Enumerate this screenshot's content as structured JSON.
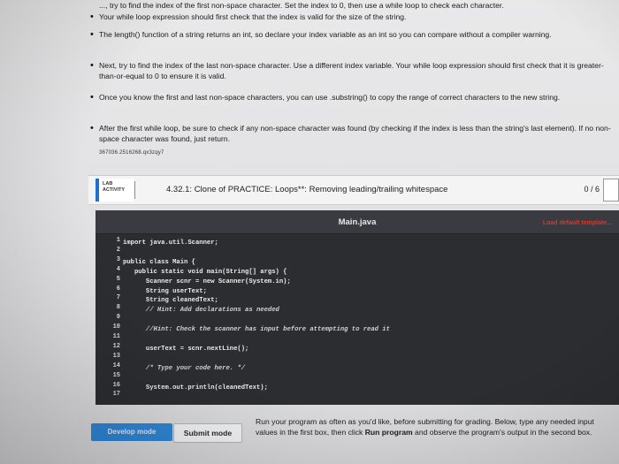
{
  "instructions": {
    "bullets": [
      "..., try to find the index of the first non-space character. Set the index to 0, then use a while loop to check each character.",
      "Your while loop expression should first check that the index is valid for the size of the string.",
      "The length() function of a string returns an int, so declare your index variable as an int so you can compare without a compiler warning.",
      "Next, try to find the index of the last non-space character. Use a different index variable. Your while loop expression should first check that it is greater-than-or-equal to 0 to ensure it is valid.",
      "Once you know the first and last non-space characters, you can use .substring() to copy the range of correct characters to the new string.",
      "After the first while loop, be sure to check if any non-space character was found (by checking if the index is less than the string's last element). If no non-space character was found, just return."
    ],
    "reference_code": "367036.2516268.qx3zqy7"
  },
  "activity": {
    "badge_top": "LAB",
    "badge_bottom": "ACTIVITY",
    "title": "4.32.1: Clone of PRACTICE: Loops**: Removing leading/trailing whitespace",
    "score": "0 / 6"
  },
  "editor": {
    "file_name": "Main.java",
    "load_template_label": "Load default template...",
    "line_numbers": [
      "1",
      "2",
      "3",
      "4",
      "5",
      "6",
      "7",
      "8",
      "9",
      "10",
      "11",
      "12",
      "13",
      "14",
      "15",
      "16",
      "17"
    ],
    "lines": [
      "import java.util.Scanner;",
      "",
      "public class Main {",
      "   public static void main(String[] args) {",
      "      Scanner scnr = new Scanner(System.in);",
      "      String userText;",
      "      String cleanedText;",
      "      // Hint: Add declarations as needed",
      "",
      "      //Hint: Check the scanner has input before attempting to read it",
      "",
      "      userText = scnr.nextLine();",
      "",
      "      /* Type your code here. */",
      "",
      "      System.out.println(cleanedText);",
      ""
    ]
  },
  "bottom": {
    "develop_mode_label": "Develop mode",
    "submit_mode_label": "Submit mode",
    "run_note_before": "Run your program as often as you'd like, before submitting for grading. Below, type any needed input values in the first box, then click ",
    "run_note_bold": "Run program",
    "run_note_after": " and observe the program's output in the second box."
  },
  "colors": {
    "accent_blue": "#2f86d6",
    "editor_bg": "#2c2d31",
    "load_template_red": "#d33a2a"
  }
}
